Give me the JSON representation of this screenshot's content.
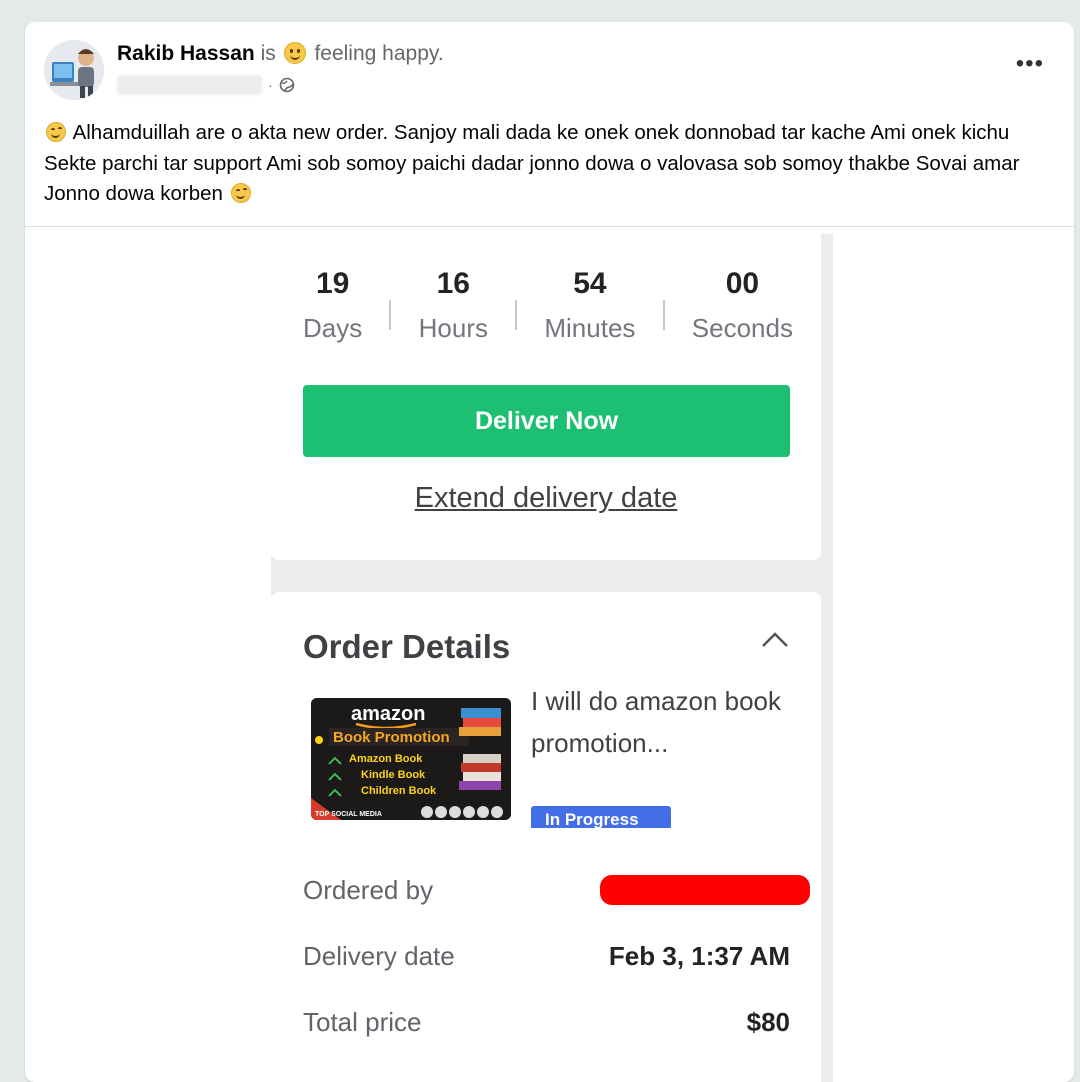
{
  "post": {
    "author": "Rakib Hassan",
    "is_text": "is",
    "feeling": "feeling happy.",
    "meta_separator": "·",
    "caption": "Alhamduillah are o akta new order. Sanjoy mali dada ke onek onek donnobad tar kache Ami onek kichu Sekte parchi tar support Ami sob somoy paichi dadar jonno dowa o valovasa sob somoy thakbe Sovai amar Jonno dowa korben",
    "more_label": "•••"
  },
  "order": {
    "countdown": [
      {
        "value": "19",
        "label": "Days"
      },
      {
        "value": "16",
        "label": "Hours"
      },
      {
        "value": "54",
        "label": "Minutes"
      },
      {
        "value": "00",
        "label": "Seconds"
      }
    ],
    "deliver_label": "Deliver Now",
    "extend_label": "Extend delivery date",
    "details_title": "Order Details",
    "gig": {
      "title": "I will do amazon book promotion...",
      "status": "In Progress",
      "thumb_heading": "amazon",
      "thumb_sub": "Book Promotion",
      "thumb_items": [
        "Amazon Book",
        "Kindle Book",
        "Children Book"
      ],
      "thumb_footer": "TOP SOCIAL MEDIA"
    },
    "rows": {
      "ordered_by_label": "Ordered by",
      "delivery_label": "Delivery date",
      "delivery_value": "Feb 3, 1:37 AM",
      "total_label": "Total price",
      "total_value": "$80"
    }
  },
  "colors": {
    "accent_green": "#1dbf73",
    "status_blue": "#446ee7",
    "redaction": "#ff0000"
  }
}
